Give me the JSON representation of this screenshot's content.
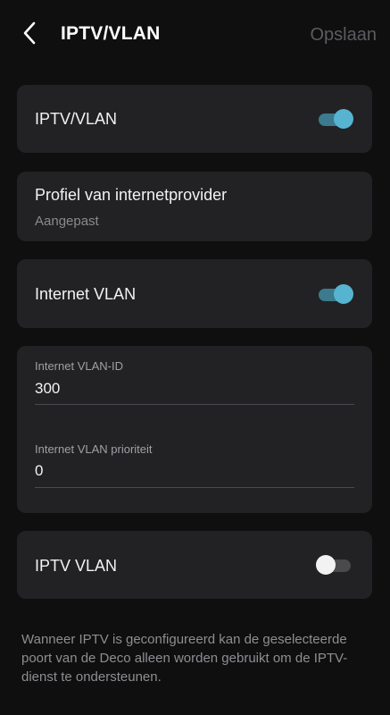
{
  "header": {
    "title": "IPTV/VLAN",
    "save_label": "Opslaan",
    "back_icon": "chevron-left-icon"
  },
  "iptv_vlan": {
    "label": "IPTV/VLAN",
    "enabled": true
  },
  "isp_profile": {
    "label": "Profiel van internetprovider",
    "value": "Aangepast"
  },
  "internet_vlan": {
    "label": "Internet VLAN",
    "enabled": true
  },
  "internet_vlan_fields": {
    "id_label": "Internet VLAN-ID",
    "id_value": "300",
    "priority_label": "Internet VLAN prioriteit",
    "priority_value": "0"
  },
  "iptv_vlan_toggle": {
    "label": "IPTV VLAN",
    "enabled": false
  },
  "footer": {
    "note": "Wanneer IPTV is geconfigureerd kan de geselecteerde poort van de Deco alleen worden gebruikt om de IPTV-dienst te ondersteunen."
  },
  "colors": {
    "background": "#0f0f10",
    "card": "#222224",
    "accent": "#57b4d0",
    "muted_text": "#8a8a8e"
  }
}
